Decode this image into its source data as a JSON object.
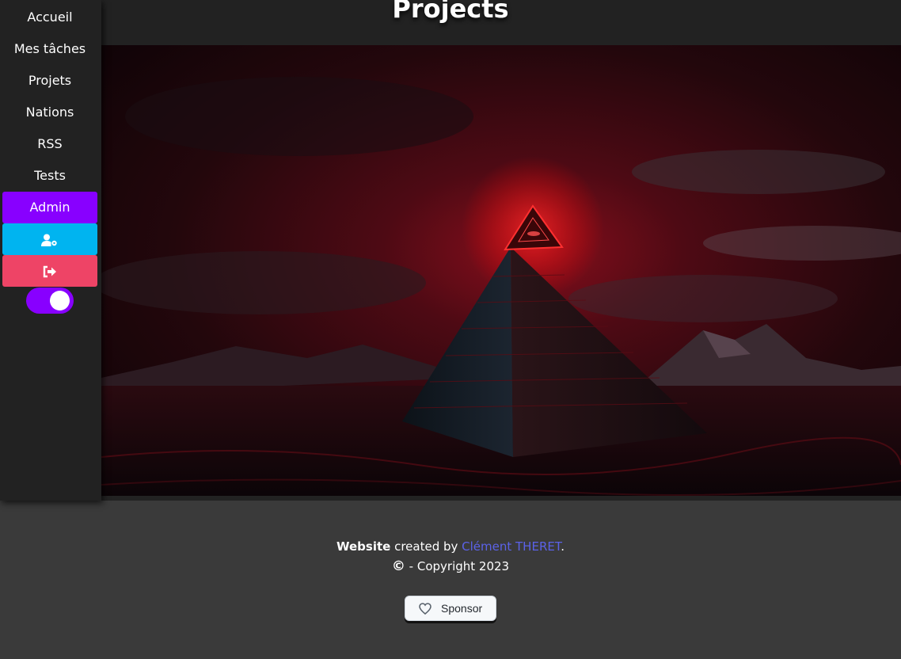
{
  "header": {
    "title": "Projects"
  },
  "sidebar": {
    "items": [
      {
        "label": "Accueil"
      },
      {
        "label": "Mes tâches"
      },
      {
        "label": "Projets"
      },
      {
        "label": "Nations"
      },
      {
        "label": "RSS"
      },
      {
        "label": "Tests"
      },
      {
        "label": "Admin"
      }
    ],
    "icons": [
      "user-cog-icon",
      "sign-out-icon"
    ],
    "theme_toggle": {
      "state": "on"
    }
  },
  "hero": {
    "image": "glowing red pyramid with eye on dark mountain landscape"
  },
  "footer": {
    "website_word": "Website",
    "created_by": " created by ",
    "author": "Clément THERET",
    "period": ".",
    "copyright_symbol": "©",
    "copyright_text": " - Copyright 2023",
    "sponsor_label": "Sponsor"
  },
  "colors": {
    "admin": "#8800ff",
    "user_button": "#00b4f0",
    "logout_button": "#ee4466",
    "link": "#5b62e8",
    "background": "#3a3a3a",
    "panel": "#222222"
  }
}
